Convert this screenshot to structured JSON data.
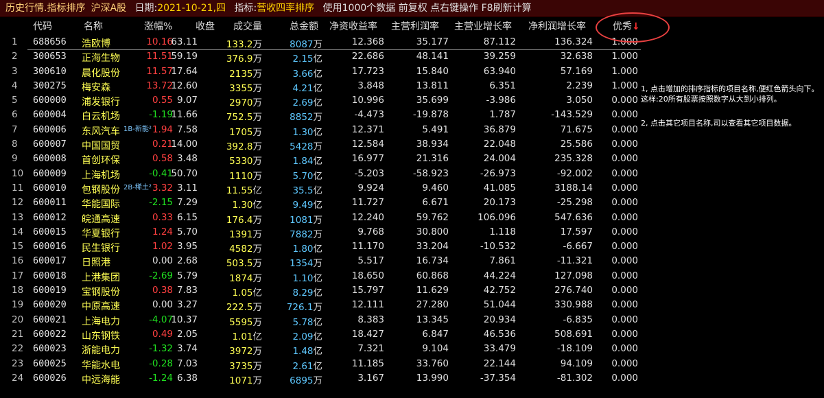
{
  "titlebar": {
    "title": "历史行情.指标排序",
    "market": "沪深A股",
    "date_label": "日期:",
    "date_value": "2021-10-21,四",
    "indicator_label": "指标:",
    "indicator_value": "营收四率排序",
    "options": "使用1000个数据 前复权 点右键操作 F8刷新计算"
  },
  "header": {
    "code": "代码",
    "name": "名称",
    "change": "涨幅%",
    "close": "收盘",
    "volume": "成交量",
    "amount": "总金额",
    "roe": "净资收益率",
    "gross_margin": "主营利润率",
    "revenue_growth": "主营业增长率",
    "profit_growth": "净利润增长率",
    "excellent": "优秀",
    "sort_arrow": "↓"
  },
  "colors": {
    "up": "#ff4040",
    "down": "#20e020",
    "name": "#ffff54",
    "amount": "#5ec8ff",
    "title_bg": "#3a0505",
    "circle": "#e84040"
  },
  "rows": [
    {
      "idx": "1",
      "code": "688656",
      "name": "浩欧博",
      "tag": "",
      "chg": "10.16",
      "close": "63.11",
      "vol": "133.2",
      "vol_unit": "万",
      "amt": "8087",
      "amt_unit": "万",
      "roe": "12.368",
      "gm": "35.177",
      "rg": "87.112",
      "ng": "136.324",
      "ex": "1.000"
    },
    {
      "idx": "2",
      "code": "300653",
      "name": "正海生物",
      "tag": "",
      "chg": "11.51",
      "close": "59.19",
      "vol": "376.9",
      "vol_unit": "万",
      "amt": "2.15",
      "amt_unit": "亿",
      "roe": "22.686",
      "gm": "48.141",
      "rg": "39.259",
      "ng": "32.638",
      "ex": "1.000"
    },
    {
      "idx": "3",
      "code": "300610",
      "name": "晨化股份",
      "tag": "",
      "chg": "11.57",
      "close": "17.64",
      "vol": "2135",
      "vol_unit": "万",
      "amt": "3.66",
      "amt_unit": "亿",
      "roe": "17.723",
      "gm": "15.840",
      "rg": "63.940",
      "ng": "57.169",
      "ex": "1.000"
    },
    {
      "idx": "4",
      "code": "300275",
      "name": "梅安森",
      "tag": "",
      "chg": "13.72",
      "close": "12.60",
      "vol": "3355",
      "vol_unit": "万",
      "amt": "4.21",
      "amt_unit": "亿",
      "roe": "3.848",
      "gm": "13.811",
      "rg": "6.351",
      "ng": "2.239",
      "ex": "1.000"
    },
    {
      "idx": "5",
      "code": "600000",
      "name": "浦发银行",
      "tag": "",
      "chg": "0.55",
      "close": "9.07",
      "vol": "2970",
      "vol_unit": "万",
      "amt": "2.69",
      "amt_unit": "亿",
      "roe": "10.996",
      "gm": "35.699",
      "rg": "-3.986",
      "ng": "3.050",
      "ex": "0.000"
    },
    {
      "idx": "6",
      "code": "600004",
      "name": "白云机场",
      "tag": "",
      "chg": "-1.19",
      "close": "11.66",
      "vol": "752.5",
      "vol_unit": "万",
      "amt": "8852",
      "amt_unit": "万",
      "roe": "-4.473",
      "gm": "-19.878",
      "rg": "1.787",
      "ng": "-143.529",
      "ex": "0.000"
    },
    {
      "idx": "7",
      "code": "600006",
      "name": "东风汽车",
      "tag": "1B-新能²",
      "chg": "1.94",
      "close": "7.58",
      "vol": "1705",
      "vol_unit": "万",
      "amt": "1.30",
      "amt_unit": "亿",
      "roe": "12.371",
      "gm": "5.491",
      "rg": "36.879",
      "ng": "71.675",
      "ex": "0.000"
    },
    {
      "idx": "8",
      "code": "600007",
      "name": "中国国贸",
      "tag": "",
      "chg": "0.21",
      "close": "14.00",
      "vol": "392.8",
      "vol_unit": "万",
      "amt": "5428",
      "amt_unit": "万",
      "roe": "12.584",
      "gm": "38.934",
      "rg": "22.048",
      "ng": "25.586",
      "ex": "0.000"
    },
    {
      "idx": "9",
      "code": "600008",
      "name": "首创环保",
      "tag": "",
      "chg": "0.58",
      "close": "3.48",
      "vol": "5330",
      "vol_unit": "万",
      "amt": "1.84",
      "amt_unit": "亿",
      "roe": "16.977",
      "gm": "21.316",
      "rg": "24.004",
      "ng": "235.328",
      "ex": "0.000"
    },
    {
      "idx": "10",
      "code": "600009",
      "name": "上海机场",
      "tag": "",
      "chg": "-0.41",
      "close": "50.70",
      "vol": "1110",
      "vol_unit": "万",
      "amt": "5.70",
      "amt_unit": "亿",
      "roe": "-5.203",
      "gm": "-58.923",
      "rg": "-26.973",
      "ng": "-92.002",
      "ex": "0.000"
    },
    {
      "idx": "11",
      "code": "600010",
      "name": "包钢股份",
      "tag": "2B-稀土²",
      "chg": "3.32",
      "close": "3.11",
      "vol": "11.55",
      "vol_unit": "亿",
      "amt": "35.5",
      "amt_unit": "亿",
      "roe": "9.924",
      "gm": "9.460",
      "rg": "41.085",
      "ng": "3188.14",
      "ex": "0.000"
    },
    {
      "idx": "12",
      "code": "600011",
      "name": "华能国际",
      "tag": "",
      "chg": "-2.15",
      "close": "7.29",
      "vol": "1.30",
      "vol_unit": "亿",
      "amt": "9.49",
      "amt_unit": "亿",
      "roe": "11.727",
      "gm": "6.671",
      "rg": "20.173",
      "ng": "-25.298",
      "ex": "0.000"
    },
    {
      "idx": "13",
      "code": "600012",
      "name": "皖通高速",
      "tag": "",
      "chg": "0.33",
      "close": "6.15",
      "vol": "176.4",
      "vol_unit": "万",
      "amt": "1081",
      "amt_unit": "万",
      "roe": "12.240",
      "gm": "59.762",
      "rg": "106.096",
      "ng": "547.636",
      "ex": "0.000"
    },
    {
      "idx": "14",
      "code": "600015",
      "name": "华夏银行",
      "tag": "",
      "chg": "1.24",
      "close": "5.70",
      "vol": "1391",
      "vol_unit": "万",
      "amt": "7882",
      "amt_unit": "万",
      "roe": "9.768",
      "gm": "30.800",
      "rg": "1.118",
      "ng": "17.597",
      "ex": "0.000"
    },
    {
      "idx": "15",
      "code": "600016",
      "name": "民生银行",
      "tag": "",
      "chg": "1.02",
      "close": "3.95",
      "vol": "4582",
      "vol_unit": "万",
      "amt": "1.80",
      "amt_unit": "亿",
      "roe": "11.170",
      "gm": "33.204",
      "rg": "-10.532",
      "ng": "-6.667",
      "ex": "0.000"
    },
    {
      "idx": "16",
      "code": "600017",
      "name": "日照港",
      "tag": "",
      "chg": "0.00",
      "close": "2.68",
      "vol": "503.5",
      "vol_unit": "万",
      "amt": "1354",
      "amt_unit": "万",
      "roe": "5.517",
      "gm": "16.734",
      "rg": "7.861",
      "ng": "-11.321",
      "ex": "0.000"
    },
    {
      "idx": "17",
      "code": "600018",
      "name": "上港集团",
      "tag": "",
      "chg": "-2.69",
      "close": "5.79",
      "vol": "1874",
      "vol_unit": "万",
      "amt": "1.10",
      "amt_unit": "亿",
      "roe": "18.650",
      "gm": "60.868",
      "rg": "44.224",
      "ng": "127.098",
      "ex": "0.000"
    },
    {
      "idx": "18",
      "code": "600019",
      "name": "宝钢股份",
      "tag": "",
      "chg": "0.38",
      "close": "7.83",
      "vol": "1.05",
      "vol_unit": "亿",
      "amt": "8.29",
      "amt_unit": "亿",
      "roe": "15.797",
      "gm": "11.629",
      "rg": "42.752",
      "ng": "276.740",
      "ex": "0.000"
    },
    {
      "idx": "19",
      "code": "600020",
      "name": "中原高速",
      "tag": "",
      "chg": "0.00",
      "close": "3.27",
      "vol": "222.5",
      "vol_unit": "万",
      "amt": "726.1",
      "amt_unit": "万",
      "roe": "12.111",
      "gm": "27.280",
      "rg": "51.044",
      "ng": "330.988",
      "ex": "0.000"
    },
    {
      "idx": "20",
      "code": "600021",
      "name": "上海电力",
      "tag": "",
      "chg": "-4.07",
      "close": "10.37",
      "vol": "5595",
      "vol_unit": "万",
      "amt": "5.78",
      "amt_unit": "亿",
      "roe": "8.383",
      "gm": "13.345",
      "rg": "20.934",
      "ng": "-6.835",
      "ex": "0.000"
    },
    {
      "idx": "21",
      "code": "600022",
      "name": "山东钢铁",
      "tag": "",
      "chg": "0.49",
      "close": "2.05",
      "vol": "1.01",
      "vol_unit": "亿",
      "amt": "2.09",
      "amt_unit": "亿",
      "roe": "18.427",
      "gm": "6.847",
      "rg": "46.536",
      "ng": "508.691",
      "ex": "0.000"
    },
    {
      "idx": "22",
      "code": "600023",
      "name": "浙能电力",
      "tag": "",
      "chg": "-1.32",
      "close": "3.74",
      "vol": "3972",
      "vol_unit": "万",
      "amt": "1.48",
      "amt_unit": "亿",
      "roe": "7.321",
      "gm": "9.104",
      "rg": "33.479",
      "ng": "-18.109",
      "ex": "0.000"
    },
    {
      "idx": "23",
      "code": "600025",
      "name": "华能水电",
      "tag": "",
      "chg": "-0.28",
      "close": "7.03",
      "vol": "3735",
      "vol_unit": "万",
      "amt": "2.61",
      "amt_unit": "亿",
      "roe": "11.185",
      "gm": "33.760",
      "rg": "22.144",
      "ng": "94.109",
      "ex": "0.000"
    },
    {
      "idx": "24",
      "code": "600026",
      "name": "中远海能",
      "tag": "",
      "chg": "-1.24",
      "close": "6.38",
      "vol": "1071",
      "vol_unit": "万",
      "amt": "6895",
      "amt_unit": "万",
      "roe": "3.167",
      "gm": "13.990",
      "rg": "-37.354",
      "ng": "-81.302",
      "ex": "0.000"
    }
  ],
  "notes": {
    "note1": "1, 点击增加的排序指标的项目名称,便红色箭头向下。这样:20所有股票按照数字从大到小排列。",
    "note2": "2, 点击其它项目名称,司以查看其它项目数据。"
  }
}
